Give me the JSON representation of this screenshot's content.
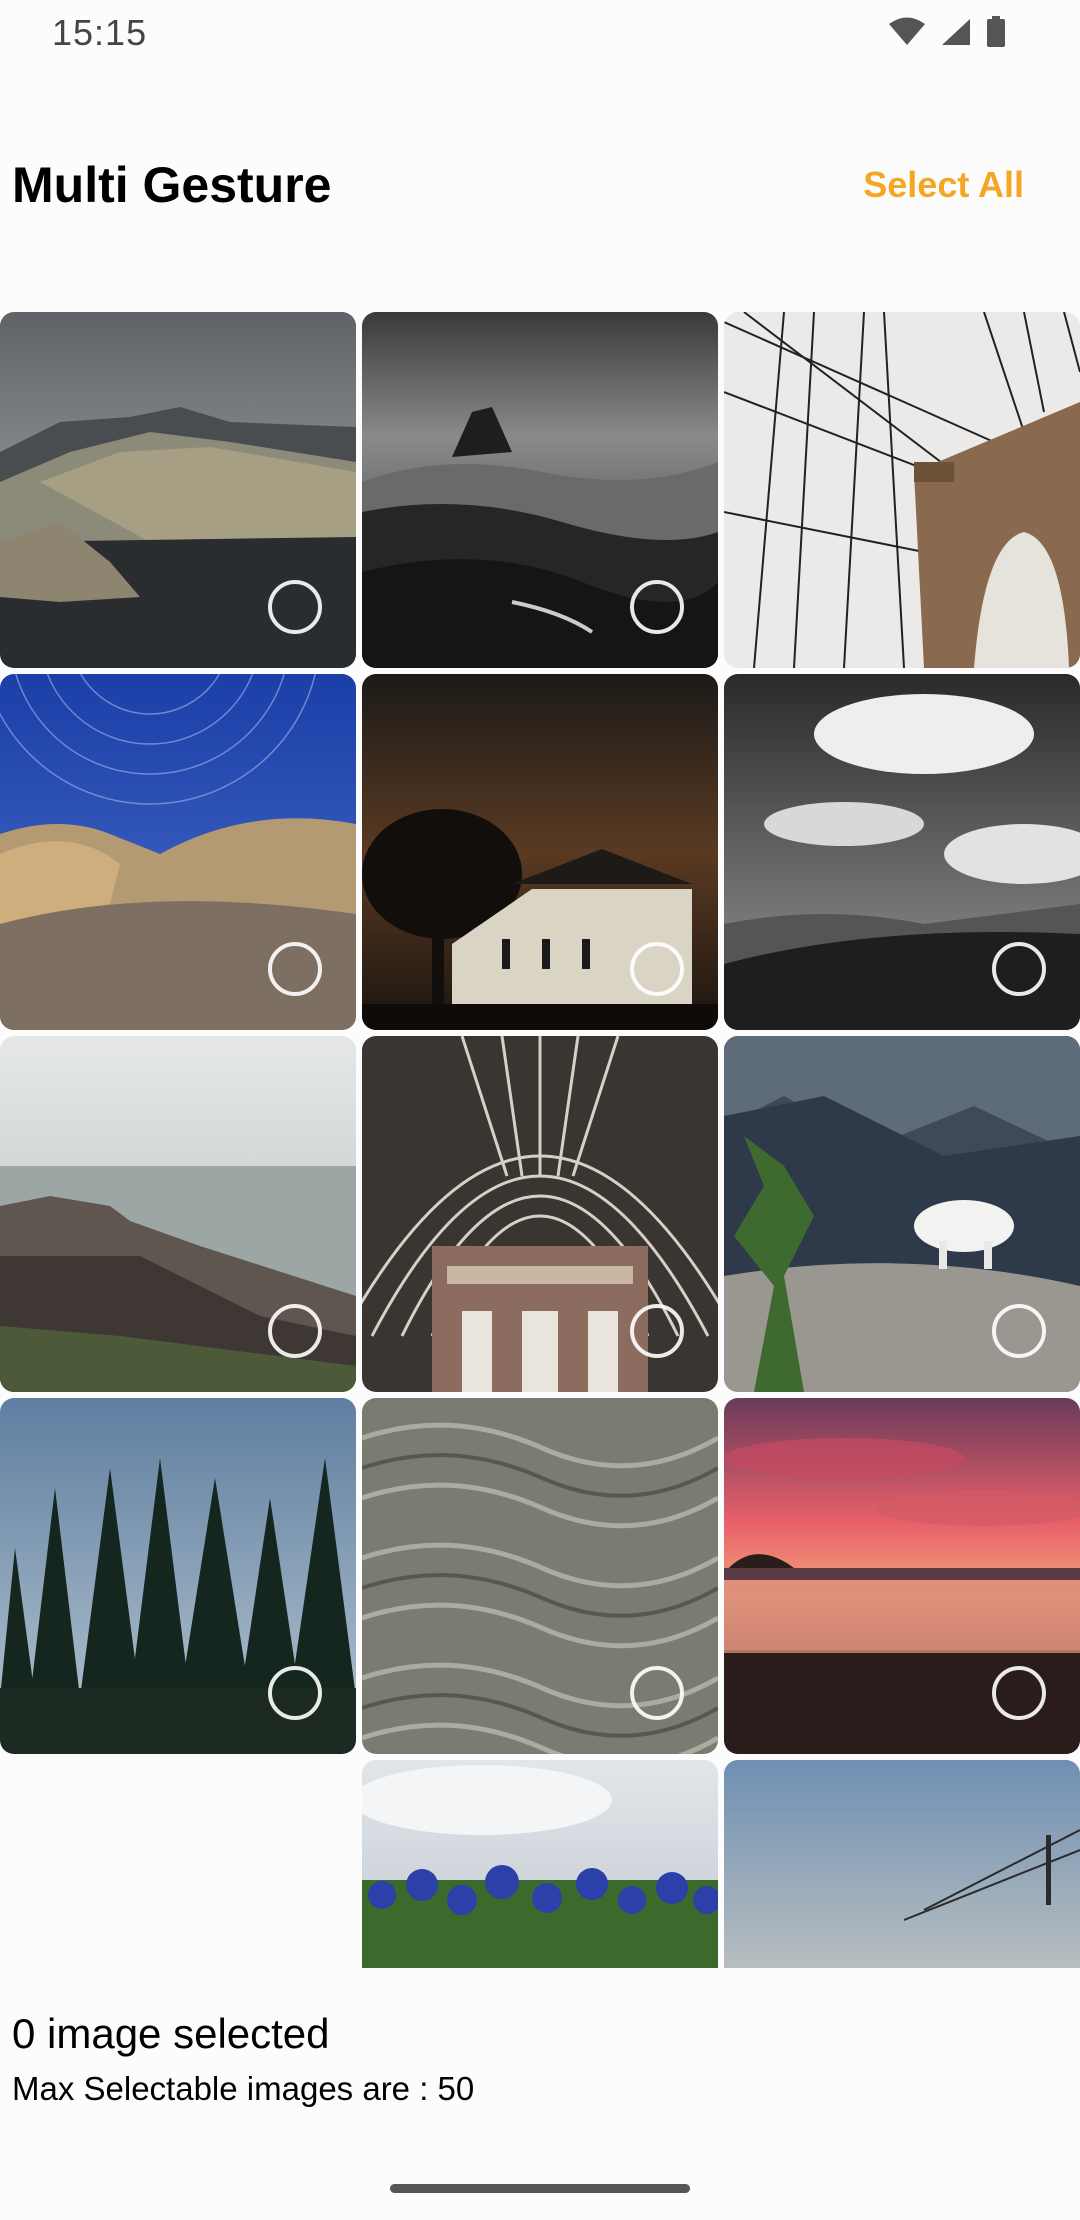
{
  "status_bar": {
    "time": "15:15",
    "icons": [
      "wifi-icon",
      "signal-icon",
      "battery-icon"
    ]
  },
  "app_bar": {
    "title": "Multi Gesture",
    "select_all_label": "Select All"
  },
  "colors": {
    "accent": "#f5a623",
    "background": "#fdfcfd"
  },
  "grid": {
    "images": [
      {
        "name": "coastal-cliffs-photo",
        "selection_ring": true
      },
      {
        "name": "rocky-shore-bw-photo",
        "selection_ring": true
      },
      {
        "name": "suspension-bridge-photo",
        "selection_ring": false
      },
      {
        "name": "star-trails-rocks-photo",
        "selection_ring": true
      },
      {
        "name": "church-night-photo",
        "selection_ring": true
      },
      {
        "name": "clouds-mountains-bw-photo",
        "selection_ring": true
      },
      {
        "name": "rocky-beach-fog-photo",
        "selection_ring": true
      },
      {
        "name": "train-station-roof-photo",
        "selection_ring": true
      },
      {
        "name": "mountain-goat-photo",
        "selection_ring": true
      },
      {
        "name": "pine-forest-photo",
        "selection_ring": true
      },
      {
        "name": "rippled-water-photo",
        "selection_ring": true
      },
      {
        "name": "sunset-beach-photo",
        "selection_ring": true
      },
      {
        "name": "blank-tile",
        "selection_ring": false
      },
      {
        "name": "bluebonnets-field-photo",
        "selection_ring": false
      },
      {
        "name": "power-lines-sky-photo",
        "selection_ring": false
      }
    ]
  },
  "footer": {
    "selected_count_text": "0 image selected",
    "max_selectable_text": "Max Selectable images are : 50"
  }
}
